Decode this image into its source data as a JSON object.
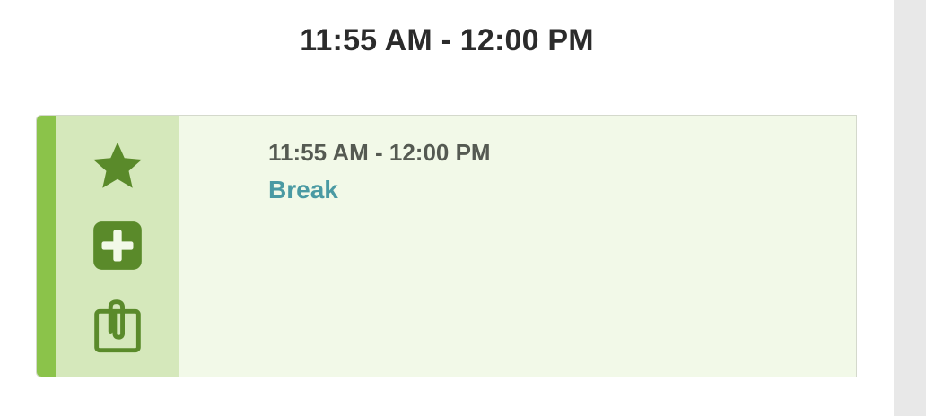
{
  "slot": {
    "heading": "11:55 AM - 12:00 PM"
  },
  "session": {
    "time": "11:55 AM - 12:00 PM",
    "title": "Break",
    "actions": [
      {
        "icon": "star-icon"
      },
      {
        "icon": "add-square-icon"
      },
      {
        "icon": "paperclip-icon"
      }
    ]
  },
  "colors": {
    "accent": "#8bc34a",
    "rail": "#d5e8bb",
    "card_bg": "#f2f9e8",
    "icon": "#5a8a2a",
    "title_link": "#4a9aa3"
  }
}
